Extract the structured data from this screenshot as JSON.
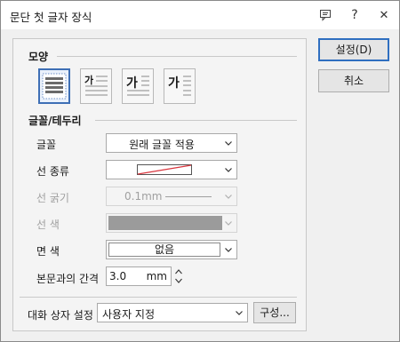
{
  "window": {
    "title": "문단 첫 글자 장식"
  },
  "titlebar": {
    "icons": [
      "chat-icon",
      "help-icon",
      "close-icon"
    ],
    "help_glyph": "?",
    "close_glyph": "✕"
  },
  "shape": {
    "label": "모양",
    "options": [
      {
        "id": "none",
        "selected": true
      },
      {
        "id": "two-lines",
        "glyph": "가"
      },
      {
        "id": "three-lines",
        "glyph": "가"
      },
      {
        "id": "margin",
        "glyph": "가"
      }
    ]
  },
  "font_border": {
    "label": "글꼴/테두리",
    "font": {
      "label": "글꼴",
      "value": "원래 글꼴 적용"
    },
    "line_type": {
      "label": "선 종류"
    },
    "line_width": {
      "label": "선 굵기",
      "value": "0.1mm",
      "disabled": true
    },
    "line_color": {
      "label": "선 색",
      "disabled": true,
      "swatch_color": "#9b9b9b"
    },
    "fill_color": {
      "label": "면 색",
      "value": "없음"
    },
    "body_gap": {
      "label": "본문과의 간격",
      "value": "3.0",
      "unit": "mm"
    }
  },
  "dialog_settings": {
    "label": "대화 상자 설정",
    "value": "사용자 지정",
    "config_button": "구성..."
  },
  "buttons": {
    "ok": "설정(D)",
    "cancel": "취소"
  },
  "colors": {
    "accent": "#2f6fc0",
    "line_red": "#d9363e"
  }
}
